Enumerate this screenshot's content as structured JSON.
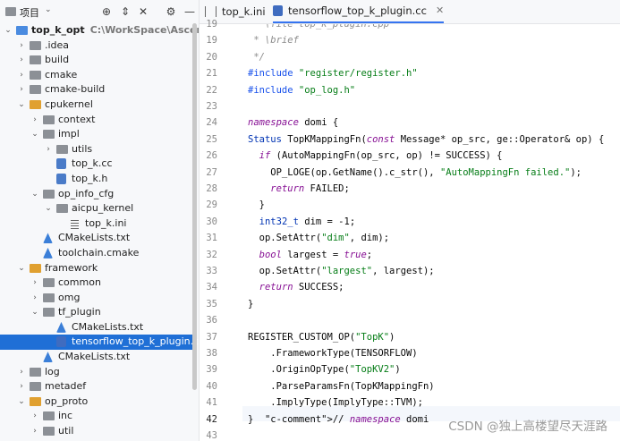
{
  "project_panel": {
    "title": "项目",
    "buttons": [
      "add",
      "collapse",
      "close",
      "settings",
      "minimize"
    ],
    "tree": [
      {
        "label": "top_k_opt",
        "path": "C:\\WorkSpace\\AscendProject",
        "depth": 0,
        "expanded": true,
        "kind": "root"
      },
      {
        "label": ".idea",
        "depth": 1,
        "expanded": false,
        "kind": "folder"
      },
      {
        "label": "build",
        "depth": 1,
        "expanded": false,
        "kind": "folder"
      },
      {
        "label": "cmake",
        "depth": 1,
        "expanded": false,
        "kind": "folder"
      },
      {
        "label": "cmake-build",
        "depth": 1,
        "expanded": false,
        "kind": "folder"
      },
      {
        "label": "cpukernel",
        "depth": 1,
        "expanded": true,
        "kind": "folder-orange"
      },
      {
        "label": "context",
        "depth": 2,
        "expanded": false,
        "kind": "folder"
      },
      {
        "label": "impl",
        "depth": 2,
        "expanded": true,
        "kind": "folder"
      },
      {
        "label": "utils",
        "depth": 3,
        "expanded": false,
        "kind": "folder"
      },
      {
        "label": "top_k.cc",
        "depth": 3,
        "kind": "file-cc"
      },
      {
        "label": "top_k.h",
        "depth": 3,
        "kind": "file-cc"
      },
      {
        "label": "op_info_cfg",
        "depth": 2,
        "expanded": true,
        "kind": "folder"
      },
      {
        "label": "aicpu_kernel",
        "depth": 3,
        "expanded": true,
        "kind": "folder"
      },
      {
        "label": "top_k.ini",
        "depth": 4,
        "kind": "file-ini"
      },
      {
        "label": "CMakeLists.txt",
        "depth": 2,
        "kind": "file-cmake"
      },
      {
        "label": "toolchain.cmake",
        "depth": 2,
        "kind": "file-cmake"
      },
      {
        "label": "framework",
        "depth": 1,
        "expanded": true,
        "kind": "folder-orange"
      },
      {
        "label": "common",
        "depth": 2,
        "expanded": false,
        "kind": "folder"
      },
      {
        "label": "omg",
        "depth": 2,
        "expanded": false,
        "kind": "folder"
      },
      {
        "label": "tf_plugin",
        "depth": 2,
        "expanded": true,
        "kind": "folder"
      },
      {
        "label": "CMakeLists.txt",
        "depth": 3,
        "kind": "file-cmake"
      },
      {
        "label": "tensorflow_top_k_plugin.cc",
        "depth": 3,
        "kind": "file-plugin",
        "selected": true
      },
      {
        "label": "CMakeLists.txt",
        "depth": 2,
        "kind": "file-cmake"
      },
      {
        "label": "log",
        "depth": 1,
        "expanded": false,
        "kind": "folder"
      },
      {
        "label": "metadef",
        "depth": 1,
        "expanded": false,
        "kind": "folder"
      },
      {
        "label": "op_proto",
        "depth": 1,
        "expanded": true,
        "kind": "folder-orange"
      },
      {
        "label": "inc",
        "depth": 2,
        "expanded": false,
        "kind": "folder"
      },
      {
        "label": "util",
        "depth": 2,
        "expanded": false,
        "kind": "folder"
      }
    ]
  },
  "editor": {
    "tabs": [
      {
        "label": "top_k.ini",
        "active": false
      },
      {
        "label": "tensorflow_top_k_plugin.cc",
        "active": true
      }
    ],
    "current_line": 42,
    "lines": [
      {
        "n": "19",
        "text": " * \\file top_k_plugin.cpp"
      },
      {
        "n": "19",
        "text": " * \\brief"
      },
      {
        "n": "20",
        "text": " */"
      },
      {
        "n": "21",
        "text": "#include \"register/register.h\""
      },
      {
        "n": "22",
        "text": "#include \"op_log.h\""
      },
      {
        "n": "23",
        "text": ""
      },
      {
        "n": "24",
        "text": "namespace domi {"
      },
      {
        "n": "25",
        "text": "Status TopKMappingFn(const Message* op_src, ge::Operator& op) {"
      },
      {
        "n": "26",
        "text": "  if (AutoMappingFn(op_src, op) != SUCCESS) {"
      },
      {
        "n": "27",
        "text": "    OP_LOGE(op.GetName().c_str(), \"AutoMappingFn failed.\");"
      },
      {
        "n": "28",
        "text": "    return FAILED;"
      },
      {
        "n": "29",
        "text": "  }"
      },
      {
        "n": "30",
        "text": "  int32_t dim = -1;"
      },
      {
        "n": "31",
        "text": "  op.SetAttr(\"dim\", dim);"
      },
      {
        "n": "32",
        "text": "  bool largest = true;"
      },
      {
        "n": "33",
        "text": "  op.SetAttr(\"largest\", largest);"
      },
      {
        "n": "34",
        "text": "  return SUCCESS;"
      },
      {
        "n": "35",
        "text": "}"
      },
      {
        "n": "36",
        "text": ""
      },
      {
        "n": "37",
        "text": "REGISTER_CUSTOM_OP(\"TopK\")"
      },
      {
        "n": "38",
        "text": "    .FrameworkType(TENSORFLOW)"
      },
      {
        "n": "39",
        "text": "    .OriginOpType(\"TopKV2\")"
      },
      {
        "n": "40",
        "text": "    .ParseParamsFn(TopKMappingFn)"
      },
      {
        "n": "41",
        "text": "    .ImplyType(ImplyType::TVM);"
      },
      {
        "n": "42",
        "text": "}  // namespace domi"
      },
      {
        "n": "43",
        "text": ""
      }
    ]
  },
  "watermark": "CSDN @独上高楼望尽天涯路",
  "colors": {
    "selection": "#1f6fd6",
    "keyword": "#0033b3",
    "string": "#067d17",
    "comment": "#8c8c8c",
    "tab_underline": "#3574f0"
  }
}
